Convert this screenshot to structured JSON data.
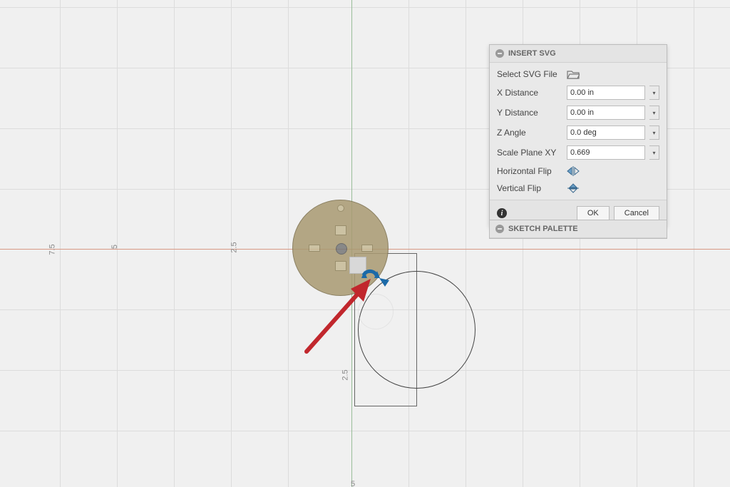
{
  "panel": {
    "title": "INSERT SVG",
    "rows": {
      "select_file": {
        "label": "Select SVG File"
      },
      "x_distance": {
        "label": "X Distance",
        "value": "0.00 in"
      },
      "y_distance": {
        "label": "Y Distance",
        "value": "0.00 in"
      },
      "z_angle": {
        "label": "Z Angle",
        "value": "0.0 deg"
      },
      "scale": {
        "label": "Scale Plane XY",
        "value": "0.669"
      },
      "h_flip": {
        "label": "Horizontal Flip"
      },
      "v_flip": {
        "label": "Vertical Flip"
      }
    },
    "buttons": {
      "ok": "OK",
      "cancel": "Cancel"
    }
  },
  "sketch_palette": {
    "title": "SKETCH PALETTE"
  },
  "axis_ticks": {
    "t1": "7.5",
    "t2": "5",
    "t3": "2.5",
    "t4": "2.5",
    "t5": "5"
  }
}
